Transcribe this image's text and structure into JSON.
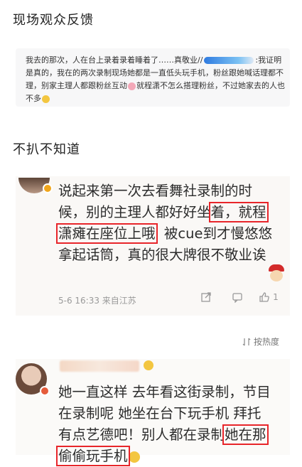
{
  "section1": {
    "title": "现场观众反馈"
  },
  "quote": {
    "text_a": "我去的那次，人在台上录着录着睡着了……真敬业//",
    "text_b": ":我证明是真的，我在的两次录制现场她都是一直低头玩手机，粉丝跟她喊话理都不理，别家主理人都跟粉丝互动",
    "text_c": "就程潇不怎么搭理粉丝，不过她家去的人也不多"
  },
  "section2": {
    "title": "不扒不知道"
  },
  "comment1": {
    "line1": "说起来第一次去看舞社录制的时候，别的主理人都好好坐",
    "highlight": "着，就程潇瘫在座位上哦",
    "line2": "被cue到才慢悠悠拿起话筒，真的很大牌很不敬业诶",
    "meta": "5-6 16:33 来自江苏",
    "like_count": "1"
  },
  "sort": {
    "label": "按热度"
  },
  "comment2": {
    "text": "她一直这样 去年看这街录制，节目在录制呢 她坐在台下玩手机 拜托 有点艺德吧！别人都在录制",
    "highlight": "她在那偷偷玩手机"
  },
  "colors": {
    "highlight_border": "#e8252a",
    "meta_gray": "#9a9a9a",
    "redaction_blue": "#2f7be0"
  },
  "icons": [
    "share-icon",
    "comment-icon",
    "like-icon",
    "sort-icon"
  ]
}
